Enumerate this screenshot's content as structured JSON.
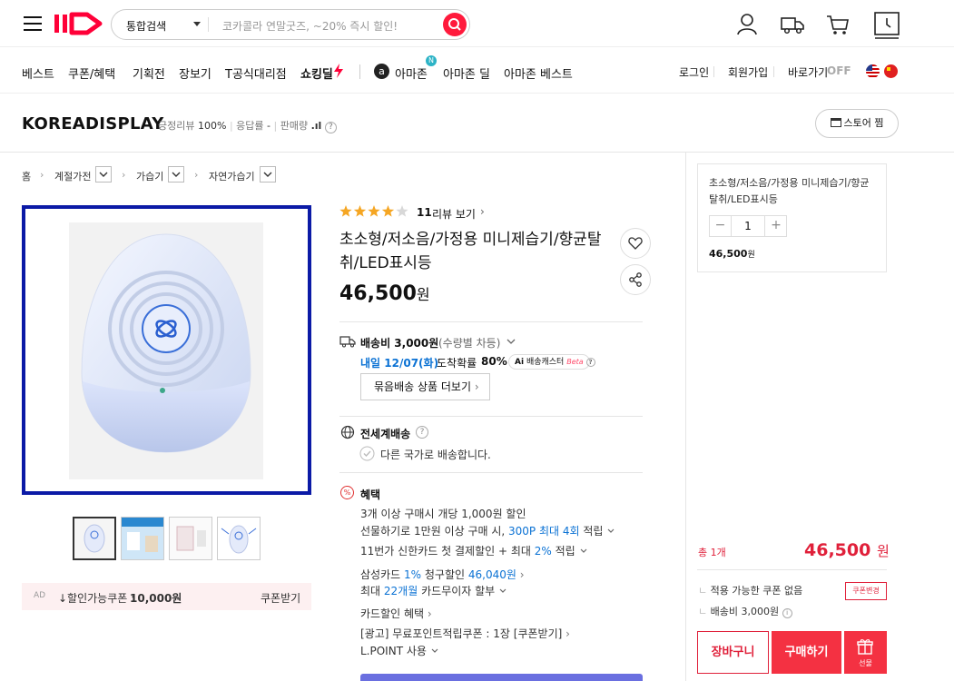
{
  "header": {
    "search_scope": "통합검색",
    "search_placeholder": "코카콜라 연말굿즈, ~20% 즉시 할인!"
  },
  "nav": {
    "left": [
      "베스트",
      "쿠폰/혜택",
      "기획전",
      "장보기",
      "T공식대리점",
      "쇼킹딜"
    ],
    "amazon": [
      "아마존",
      "아마존 딜",
      "아마존 베스트"
    ],
    "amazon_badge": "N",
    "right": [
      "로그인",
      "회원가입",
      "바로가기",
      "OFF"
    ]
  },
  "store": {
    "name": "KOREADISPLAY",
    "meta_positive_label": "긍정리뷰",
    "meta_positive_value": "100%",
    "meta_response_label": "응답률",
    "meta_response_value": "-",
    "meta_sales_label": "판매량",
    "store_button": "스토어 찜"
  },
  "breadcrumb": [
    "홈",
    "계절가전",
    "가습기",
    "자연가습기"
  ],
  "product": {
    "rating": 4,
    "review_count": "11",
    "review_label": "리뷰 보기",
    "title": "초소형/저소음/가정용 미니제습기/향균탈취/LED표시등",
    "price_number": "46,500",
    "price_unit": "원"
  },
  "shipping": {
    "fee_label": "배송비 3,000원",
    "fee_note": "(수량별 차등)",
    "arrival_date": "내일 12/07(화)",
    "arrival_prob_label": "도착확률",
    "arrival_prob": "80%",
    "ai_label": "배송캐스터",
    "ai_badge": "Ai",
    "ai_beta": "Beta",
    "bundle_button": "묶음배송 상품 더보기"
  },
  "global": {
    "title": "전세계배송",
    "note": "다른 국가로 배송합니다."
  },
  "benefits": {
    "title": "혜택",
    "line1": "3개 이상 구매시 개당 1,000원 할인",
    "line2_prefix": "선물하기로 1만원 이상 구매 시,",
    "line2_point": "300P 최대 4회",
    "line2_suffix": "적립",
    "line3_prefix": "11번가 신한카드 첫 결제할인 + 최대",
    "line3_pct": "2%",
    "line3_suffix": "적립",
    "line4_prefix": "삼성카드",
    "line4_pct": "1%",
    "line4_mid": "청구할인",
    "line4_amount": "46,040원",
    "line5_prefix": "최대",
    "line5_months": "22개월",
    "line5_suffix": "카드무이자 할부",
    "line6": "카드할인 혜택",
    "line7": "[광고] 무료포인트적립쿠폰 : 1장 [쿠폰받기]",
    "line8": "L.POINT 사용"
  },
  "coupon": {
    "ad": "AD",
    "text_prefix": "↓할인가능쿠폰 :",
    "amount": "10,000원",
    "button": "쿠폰받기"
  },
  "side": {
    "item_name": "초소형/저소음/가정용 미니제습기/향균탈취/LED표시등",
    "qty": "1",
    "item_price": "46,500",
    "item_price_unit": "원",
    "total_label": "총 1개",
    "total_price": "46,500",
    "total_unit": "원",
    "coupon_none": "적용 가능한 쿠폰 없음",
    "coupon_change": "쿠폰변경",
    "shipping": "배송비 3,000원",
    "cart_button": "장바구니",
    "buy_button": "구매하기",
    "gift_button": "선물"
  },
  "colors": {
    "brand": "#ff0038",
    "accent_blue": "#0b72d4",
    "image_border": "#0b1aa6"
  }
}
